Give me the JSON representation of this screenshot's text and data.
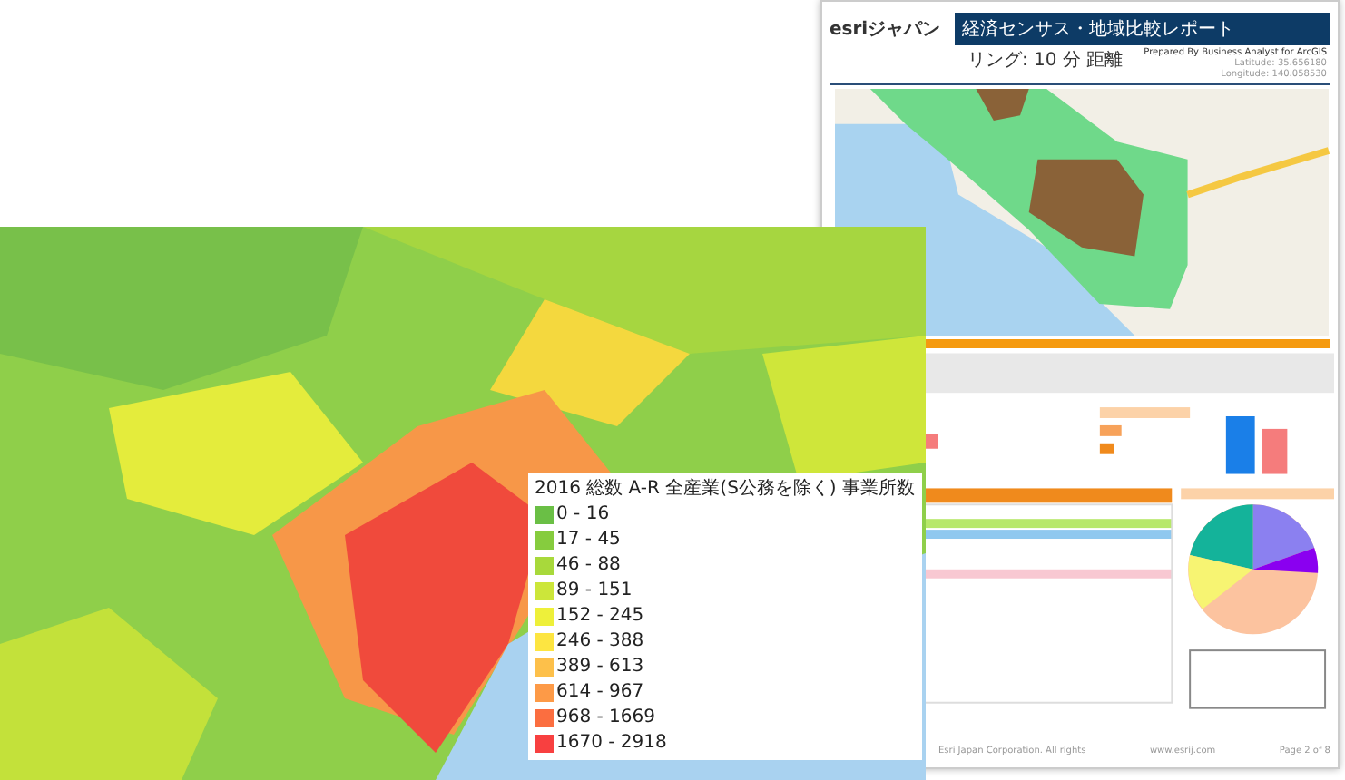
{
  "report": {
    "logo": "esriジャパン",
    "title": "経済センサス・地域比較レポート",
    "area": "リング: 10 分 距離",
    "prepared": "Prepared By Business Analyst for ArcGIS",
    "latitude": "Latitude: 35.656180",
    "longitude": "Longitude: 140.058530",
    "footer_copyright": "Esri Japan Corporation. All rights",
    "footer_site": "www.esrij.com",
    "footer_page": "Page 2 of 8"
  },
  "map_legend": {
    "title": "2016 総数 A-R 全産業(S公務を除く) 事業所数",
    "classes": [
      {
        "label": "0 - 16",
        "color": "#6abf45"
      },
      {
        "label": "17 - 45",
        "color": "#86cc3e"
      },
      {
        "label": "46 - 88",
        "color": "#a8d93b"
      },
      {
        "label": "89 - 151",
        "color": "#cce63a"
      },
      {
        "label": "152 - 245",
        "color": "#eef03a"
      },
      {
        "label": "246 - 388",
        "color": "#fde541"
      },
      {
        "label": "389 - 613",
        "color": "#fdc04a"
      },
      {
        "label": "614 - 967",
        "color": "#fd9a47"
      },
      {
        "label": "968 - 1669",
        "color": "#fb6e40"
      },
      {
        "label": "1670 - 2918",
        "color": "#f84040"
      }
    ]
  }
}
